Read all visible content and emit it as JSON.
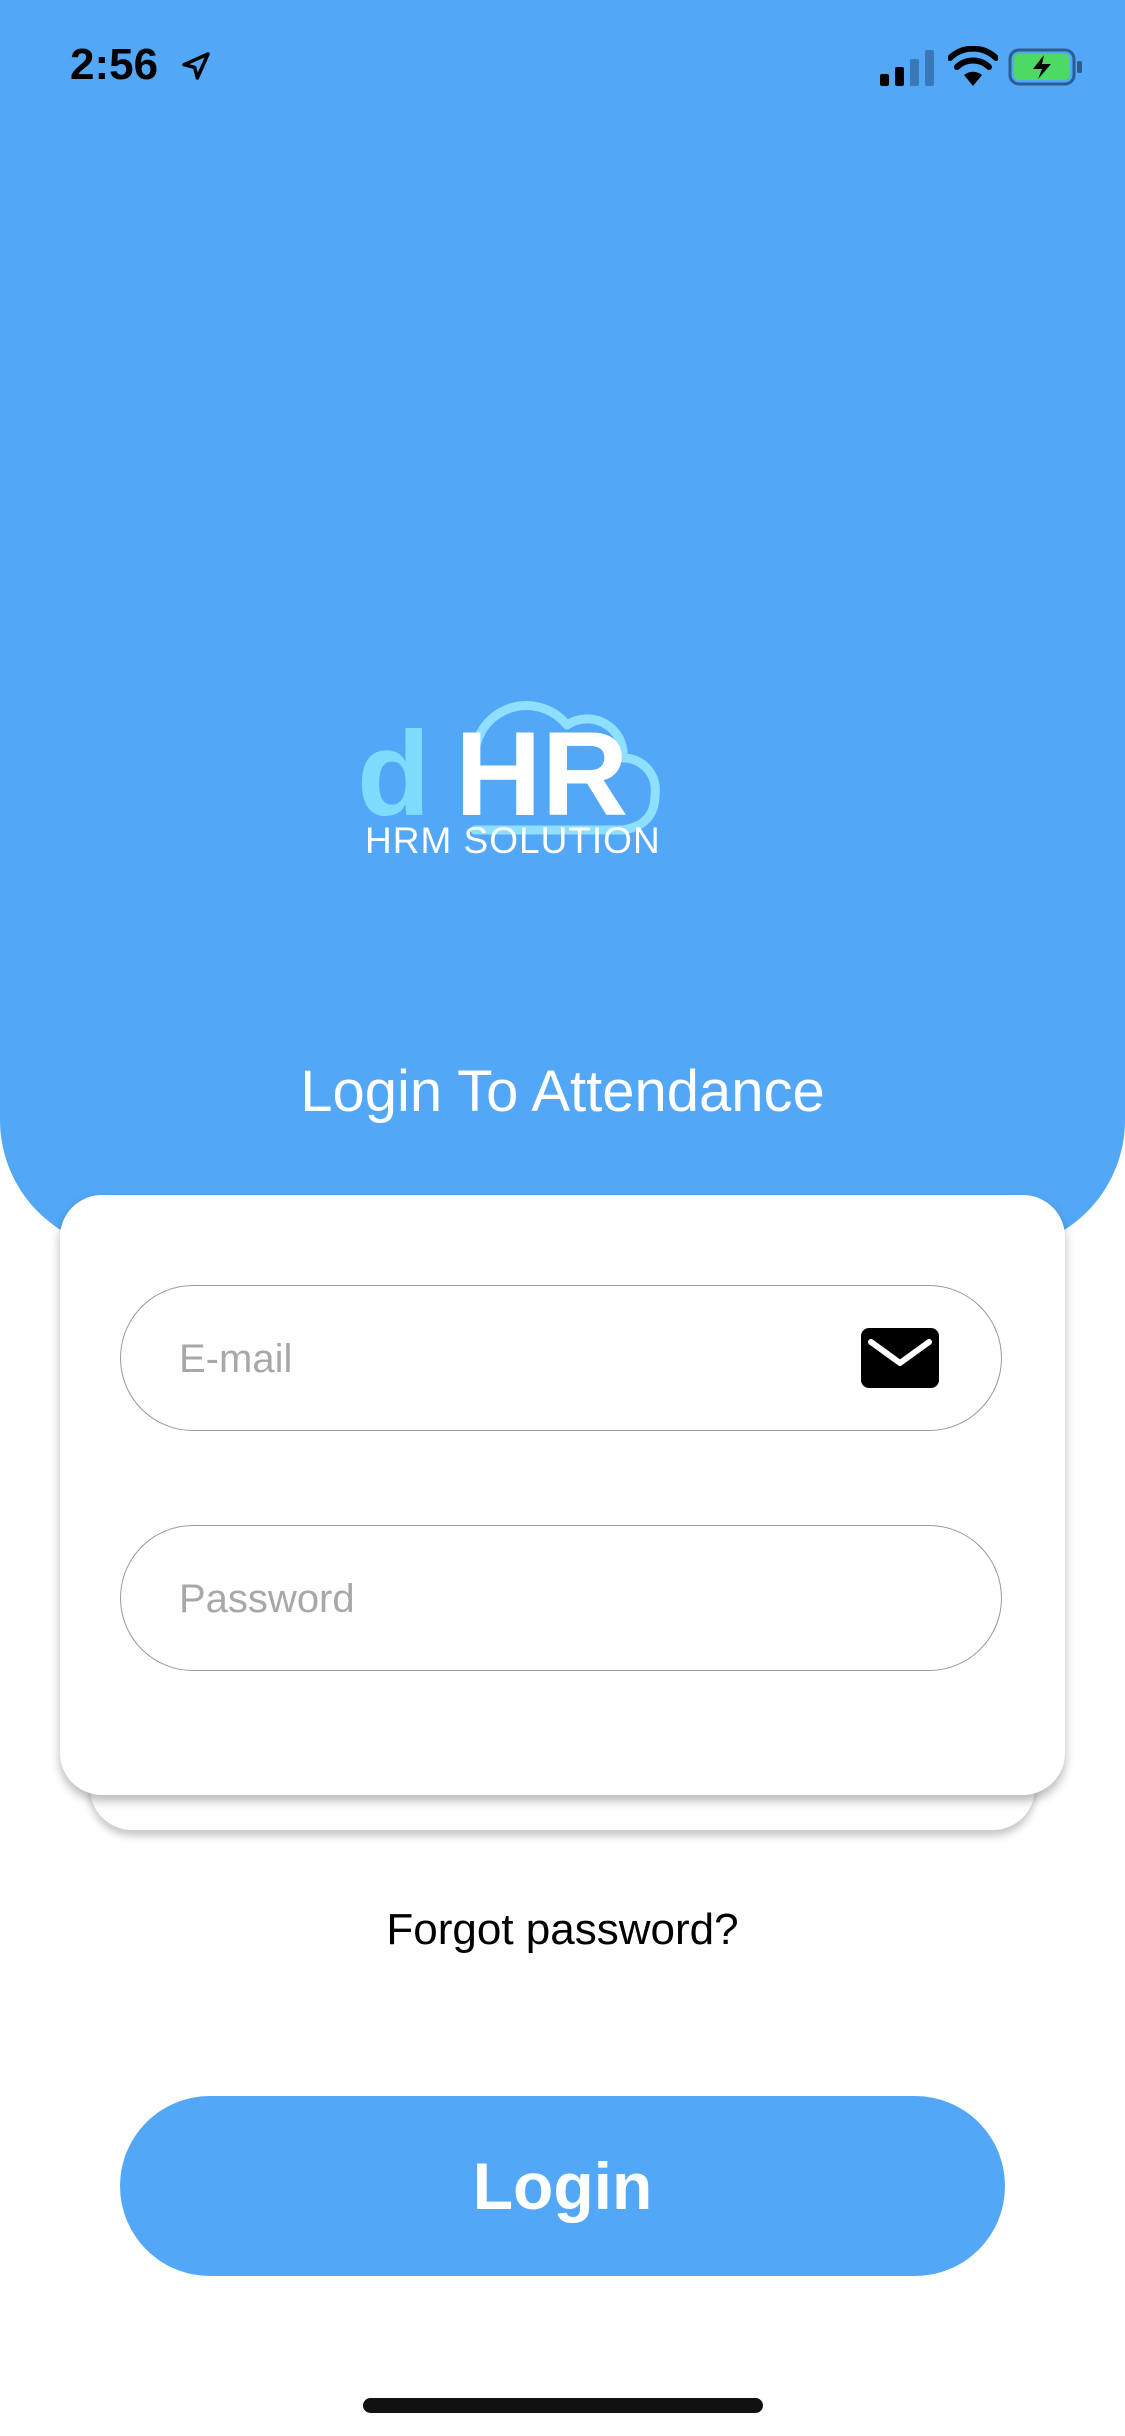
{
  "status_bar": {
    "time": "2:56",
    "icons": [
      "location-arrow-icon",
      "cellular-signal-icon",
      "wifi-icon",
      "battery-charging-icon"
    ]
  },
  "logo": {
    "letter_d": "d",
    "letters_hr": "HR",
    "caption": "HRM SOLUTION",
    "icon": "cloud-icon",
    "colors": {
      "d": "#7fdcff",
      "hr": "#ffffff",
      "cloud": "#8fe0ff"
    }
  },
  "page": {
    "title": "Login To Attendance"
  },
  "form": {
    "email_placeholder": "E-mail",
    "email_icon": "mail-icon",
    "password_placeholder": "Password"
  },
  "links": {
    "forgot_password": "Forgot password?"
  },
  "actions": {
    "login_label": "Login"
  },
  "colors": {
    "primary": "#53a7f7",
    "background": "#ffffff",
    "placeholder": "#a8a8a8",
    "field_border": "#9a9a9a"
  }
}
